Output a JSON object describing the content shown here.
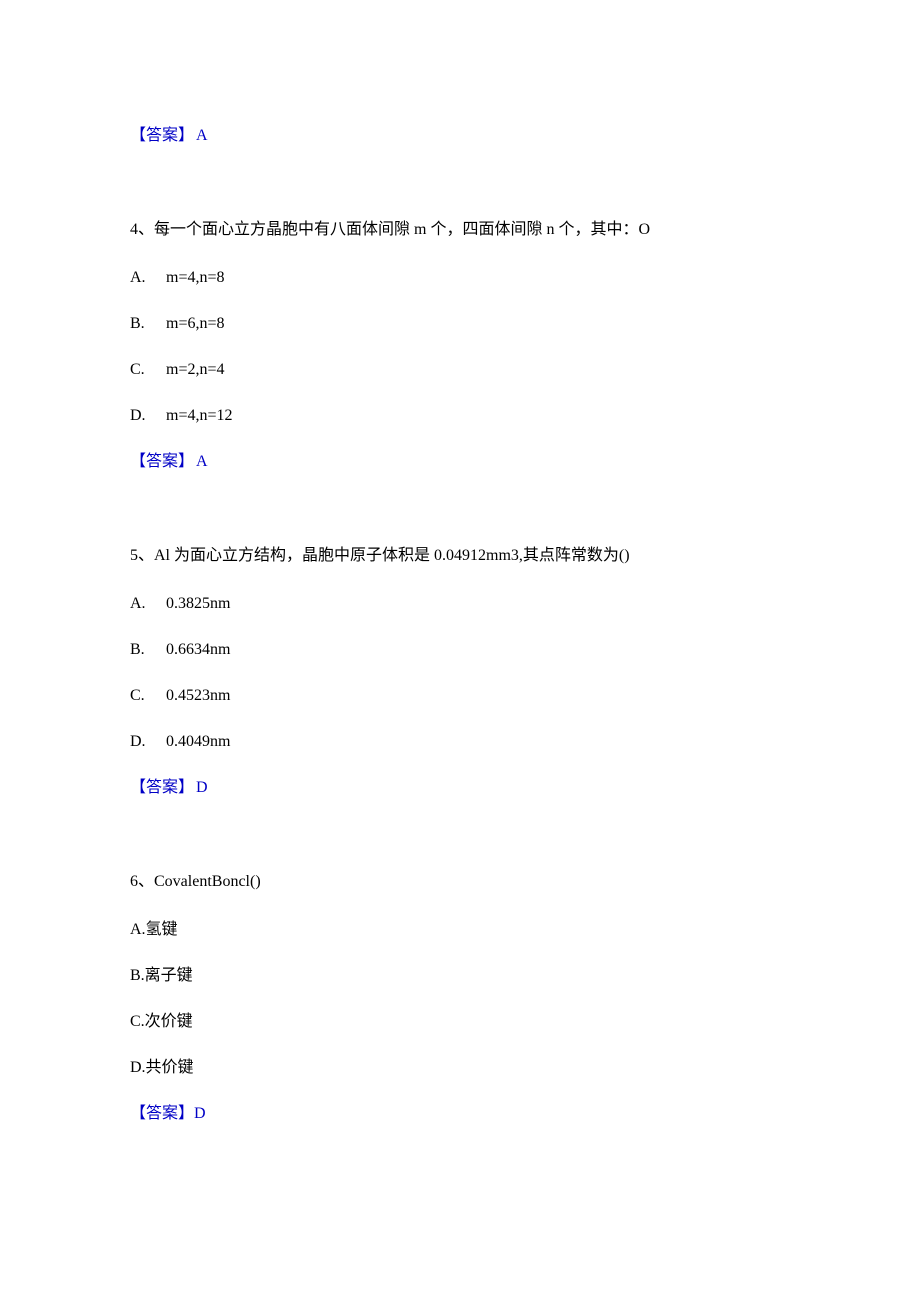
{
  "q3_answer": {
    "label": "【答案】",
    "letter": "A"
  },
  "q4": {
    "stem": "4、每一个面心立方晶胞中有八面体间隙 m 个，四面体间隙 n 个，其中：O",
    "options": [
      {
        "letter": "A.",
        "text": "m=4,n=8"
      },
      {
        "letter": "B.",
        "text": "m=6,n=8"
      },
      {
        "letter": "C.",
        "text": "m=2,n=4"
      },
      {
        "letter": "D.",
        "text": "m=4,n=12"
      }
    ],
    "answer": {
      "label": "【答案】",
      "letter": "A"
    }
  },
  "q5": {
    "stem": "5、Al 为面心立方结构，晶胞中原子体积是 0.04912mm3,其点阵常数为()",
    "options": [
      {
        "letter": "A.",
        "text": "0.3825nm"
      },
      {
        "letter": "B.",
        "text": "0.6634nm"
      },
      {
        "letter": "C.",
        "text": "0.4523nm"
      },
      {
        "letter": "D.",
        "text": "0.4049nm"
      }
    ],
    "answer": {
      "label": "【答案】",
      "letter": "D"
    }
  },
  "q6": {
    "stem": "6、CovalentBoncl()",
    "options": [
      {
        "text": "A.氢键"
      },
      {
        "text": "B.离子键"
      },
      {
        "text": "C.次价键"
      },
      {
        "text": "D.共价键"
      }
    ],
    "answer": {
      "label": "【答案】",
      "letter": "D"
    }
  }
}
